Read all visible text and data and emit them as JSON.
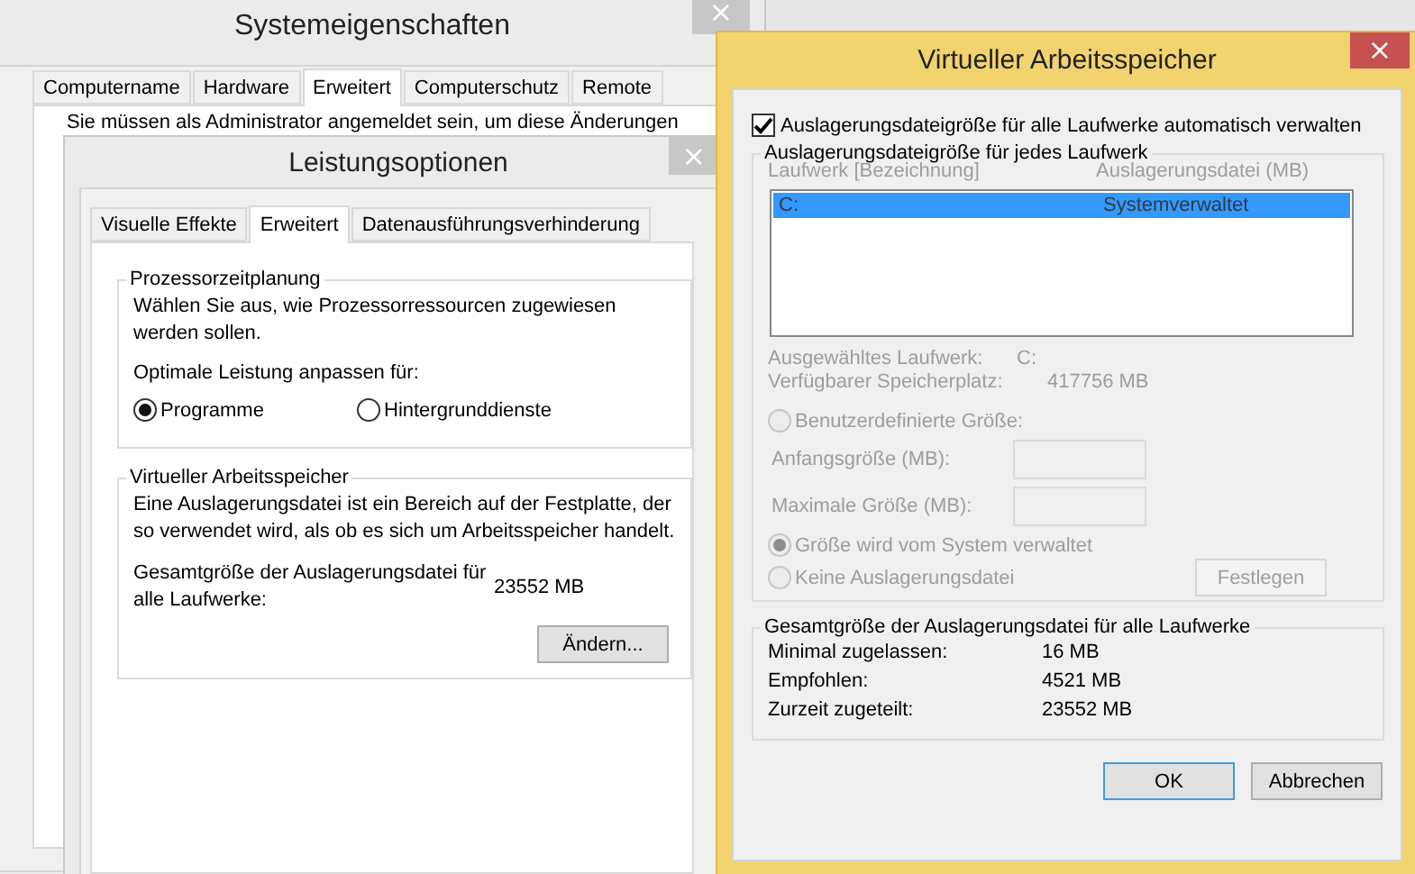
{
  "system_properties": {
    "title": "Systemeigenschaften",
    "close": "×",
    "tabs": [
      {
        "label": "Computername",
        "selected": false
      },
      {
        "label": "Hardware",
        "selected": false
      },
      {
        "label": "Erweitert",
        "selected": true
      },
      {
        "label": "Computerschutz",
        "selected": false
      },
      {
        "label": "Remote",
        "selected": false
      }
    ],
    "notice": "Sie müssen als Administrator angemeldet sein, um diese Änderungen"
  },
  "performance_options": {
    "title": "Leistungsoptionen",
    "close": "×",
    "tabs": [
      {
        "label": "Visuelle Effekte",
        "selected": false
      },
      {
        "label": "Erweitert",
        "selected": true
      },
      {
        "label": "Datenausführungsverhinderung",
        "selected": false
      }
    ],
    "scheduling": {
      "heading": "Prozessorzeitplanung",
      "description": "Wählen Sie aus, wie Prozessorressourcen zugewiesen werden sollen.",
      "prompt": "Optimale Leistung anpassen für:",
      "options": [
        {
          "label": "Programme",
          "selected": true
        },
        {
          "label": "Hintergrunddienste",
          "selected": false
        }
      ]
    },
    "virtual_memory": {
      "heading": "Virtueller Arbeitsspeicher",
      "description": "Eine Auslagerungsdatei ist ein Bereich auf der Festplatte, der so verwendet wird, als ob es sich um Arbeitsspeicher handelt.",
      "total_label": "Gesamtgröße der Auslagerungsdatei für alle Laufwerke:",
      "total_value": "23552 MB",
      "button": "Ändern..."
    }
  },
  "virtual_memory": {
    "title": "Virtueller Arbeitsspeicher",
    "close": "×",
    "auto_manage": {
      "label": "Auslagerungsdateigröße für alle Laufwerke automatisch verwalten",
      "checked": true
    },
    "drives": {
      "heading": "Auslagerungsdateigröße für jedes Laufwerk",
      "disabled": true,
      "columns": [
        "Laufwerk [Bezeichnung]",
        "Auslagerungsdatei (MB)"
      ],
      "rows": [
        {
          "drive": "C:",
          "paging_file": "Systemverwaltet",
          "selected": true
        }
      ],
      "info": [
        {
          "label": "Ausgewähltes Laufwerk:",
          "value": "C:"
        },
        {
          "label": "Verfügbarer Speicherplatz:",
          "value": "417756 MB"
        }
      ],
      "size_options": [
        {
          "label": "Benutzerdefinierte Größe:",
          "selected": false
        },
        {
          "label": "Größe wird vom System verwaltet",
          "selected": true
        },
        {
          "label": "Keine Auslagerungsdatei",
          "selected": false
        }
      ],
      "size_fields": [
        {
          "label": "Anfangsgröße (MB):"
        },
        {
          "label": "Maximale Größe (MB):"
        }
      ],
      "set_button": "Festlegen"
    },
    "totals": {
      "heading": "Gesamtgröße der Auslagerungsdatei für alle Laufwerke",
      "rows": [
        {
          "label": "Minimal zugelassen:",
          "value": "16 MB"
        },
        {
          "label": "Empfohlen:",
          "value": "4521 MB"
        },
        {
          "label": "Zurzeit zugeteilt:",
          "value": "23552 MB"
        }
      ]
    },
    "buttons": [
      {
        "label": "OK",
        "default": true
      },
      {
        "label": "Abbrechen",
        "default": false
      }
    ]
  }
}
